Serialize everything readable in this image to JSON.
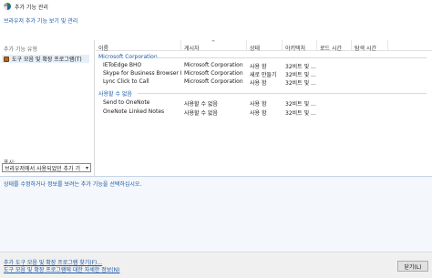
{
  "window": {
    "title": "추가 기능 관리"
  },
  "heading": "브라우저 추가 기능 보기 및 관리",
  "left_pane": {
    "section_title": "추가 기능 유형",
    "types": [
      {
        "label": "도구 모음 및 확장 프로그램(T)"
      }
    ],
    "show_label": "표시:",
    "show_value": "브라우저에서 사용되었던 추가 기"
  },
  "columns": [
    "이름",
    "게시자",
    "상태",
    "아키텍처",
    "로드 시간",
    "탐색 시간"
  ],
  "groups": [
    {
      "name": "Microsoft Corporation",
      "rows": [
        {
          "name": "IEToEdge BHO",
          "publisher": "Microsoft Corporation",
          "status": "사용 함",
          "arch": "32비트 및 ..."
        },
        {
          "name": "Skype for Business Browser He...",
          "publisher": "Microsoft Corporation",
          "status": "새로 만들기",
          "arch": "32비트 및 ..."
        },
        {
          "name": "Lync Click to Call",
          "publisher": "Microsoft Corporation",
          "status": "사용 함",
          "arch": "32비트 및 ..."
        }
      ]
    },
    {
      "name": "사용할 수 없음",
      "rows": [
        {
          "name": "Send to OneNote",
          "publisher": "사용할 수 없음",
          "status": "사용 함",
          "arch": "32비트 및 ..."
        },
        {
          "name": "OneNote Linked Notes",
          "publisher": "사용할 수 없음",
          "status": "사용 함",
          "arch": "32비트 및 ..."
        }
      ]
    }
  ],
  "info_text": "상태를 수정하거나 정보를 보려는 추가 기능을 선택하십시오.",
  "links": [
    "추가 도구 모음 및 확장 프로그램 찾기(F)...",
    "도구 모음 및 확장 프로그램에 대한 자세한 정보(N)"
  ],
  "close_button": {
    "label": "닫기(L)"
  }
}
